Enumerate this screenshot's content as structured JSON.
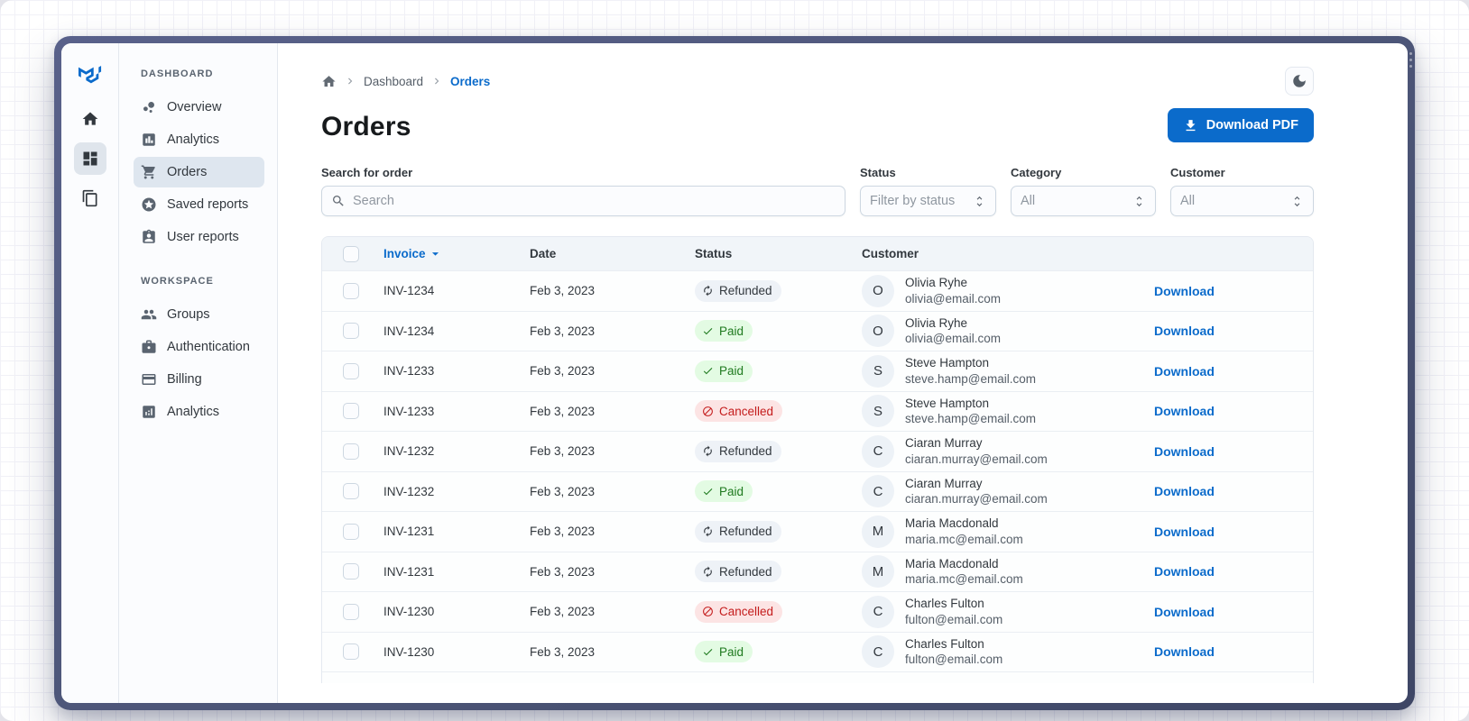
{
  "window": {
    "frame_color": "#4c5577"
  },
  "brand": {
    "logo_icon": "mui-logo",
    "logo_color": "#0b6bcb"
  },
  "rail": {
    "items": [
      {
        "icon": "home-icon",
        "selected": false
      },
      {
        "icon": "dashboard-grid-icon",
        "selected": true
      },
      {
        "icon": "layers-icon",
        "selected": false
      }
    ]
  },
  "sidebar": {
    "sections": [
      {
        "label": "DASHBOARD",
        "items": [
          {
            "icon": "bubble-chart-icon",
            "label": "Overview",
            "selected": false
          },
          {
            "icon": "bar-chart-icon",
            "label": "Analytics",
            "selected": false
          },
          {
            "icon": "shopping-cart-icon",
            "label": "Orders",
            "selected": true
          },
          {
            "icon": "star-circle-icon",
            "label": "Saved reports",
            "selected": false
          },
          {
            "icon": "person-card-icon",
            "label": "User reports",
            "selected": false
          }
        ]
      },
      {
        "label": "WORKSPACE",
        "items": [
          {
            "icon": "groups-icon",
            "label": "Groups",
            "selected": false
          },
          {
            "icon": "badge-icon",
            "label": "Authentication",
            "selected": false
          },
          {
            "icon": "credit-card-icon",
            "label": "Billing",
            "selected": false
          },
          {
            "icon": "analytics-box-icon",
            "label": "Analytics",
            "selected": false
          }
        ]
      }
    ]
  },
  "breadcrumb": {
    "home_icon": "home-icon",
    "items": [
      {
        "label": "Dashboard",
        "current": false
      },
      {
        "label": "Orders",
        "current": true
      }
    ]
  },
  "header": {
    "theme_toggle_icon": "moon-icon"
  },
  "page": {
    "title": "Orders",
    "download_button": {
      "label": "Download PDF",
      "icon": "download-icon"
    }
  },
  "filters": {
    "search": {
      "label": "Search for order",
      "placeholder": "Search",
      "icon": "search-icon"
    },
    "selects": [
      {
        "label": "Status",
        "value": "Filter by status"
      },
      {
        "label": "Category",
        "value": "All"
      },
      {
        "label": "Customer",
        "value": "All"
      }
    ]
  },
  "table": {
    "columns": [
      "Invoice",
      "Date",
      "Status",
      "Customer"
    ],
    "sort": {
      "column": "Invoice",
      "direction": "desc"
    },
    "row_action_label": "Download",
    "status_styles": {
      "Paid": {
        "type": "success",
        "icon": "check-icon",
        "bg": "#e3fbe3",
        "text": "#1f7a1f"
      },
      "Refunded": {
        "type": "neutral",
        "icon": "autorenew-icon",
        "bg": "#eef2f7",
        "text": "#32383e"
      },
      "Cancelled": {
        "type": "danger",
        "icon": "block-icon",
        "bg": "#fce4e4",
        "text": "#c41c1c"
      }
    },
    "rows": [
      {
        "invoice": "INV-1234",
        "date": "Feb 3, 2023",
        "status": "Refunded",
        "initial": "O",
        "name": "Olivia Ryhe",
        "email": "olivia@email.com"
      },
      {
        "invoice": "INV-1234",
        "date": "Feb 3, 2023",
        "status": "Paid",
        "initial": "O",
        "name": "Olivia Ryhe",
        "email": "olivia@email.com"
      },
      {
        "invoice": "INV-1233",
        "date": "Feb 3, 2023",
        "status": "Paid",
        "initial": "S",
        "name": "Steve Hampton",
        "email": "steve.hamp@email.com"
      },
      {
        "invoice": "INV-1233",
        "date": "Feb 3, 2023",
        "status": "Cancelled",
        "initial": "S",
        "name": "Steve Hampton",
        "email": "steve.hamp@email.com"
      },
      {
        "invoice": "INV-1232",
        "date": "Feb 3, 2023",
        "status": "Refunded",
        "initial": "C",
        "name": "Ciaran Murray",
        "email": "ciaran.murray@email.com"
      },
      {
        "invoice": "INV-1232",
        "date": "Feb 3, 2023",
        "status": "Paid",
        "initial": "C",
        "name": "Ciaran Murray",
        "email": "ciaran.murray@email.com"
      },
      {
        "invoice": "INV-1231",
        "date": "Feb 3, 2023",
        "status": "Refunded",
        "initial": "M",
        "name": "Maria Macdonald",
        "email": "maria.mc@email.com"
      },
      {
        "invoice": "INV-1231",
        "date": "Feb 3, 2023",
        "status": "Refunded",
        "initial": "M",
        "name": "Maria Macdonald",
        "email": "maria.mc@email.com"
      },
      {
        "invoice": "INV-1230",
        "date": "Feb 3, 2023",
        "status": "Cancelled",
        "initial": "C",
        "name": "Charles Fulton",
        "email": "fulton@email.com"
      },
      {
        "invoice": "INV-1230",
        "date": "Feb 3, 2023",
        "status": "Paid",
        "initial": "C",
        "name": "Charles Fulton",
        "email": "fulton@email.com"
      },
      {
        "invoice": "",
        "date": "",
        "status": "",
        "initial": "",
        "name": "",
        "email": "",
        "partial": true
      }
    ]
  },
  "colors": {
    "primary": "#0b6bcb",
    "success_bg": "#e3fbe3",
    "success_text": "#1f7a1f",
    "danger_bg": "#fce4e4",
    "danger_text": "#c41c1c",
    "neutral_bg": "#eef2f7",
    "neutral_text": "#32383e"
  }
}
